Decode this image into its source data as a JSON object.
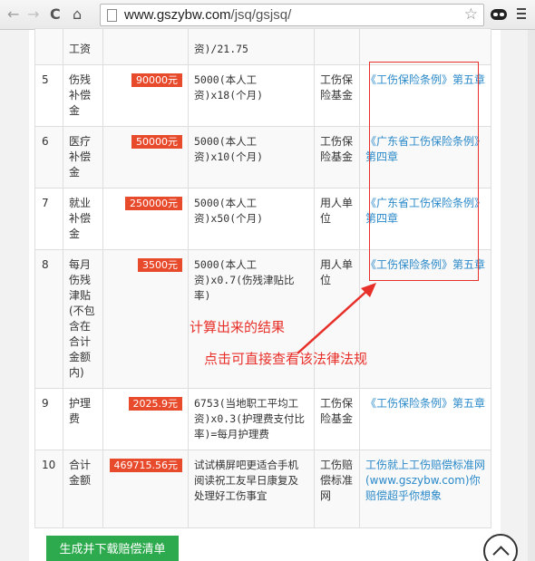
{
  "browser": {
    "url_host": "www.gszybw.com",
    "url_path": "/jsq/gsjsq/"
  },
  "table": {
    "rows": [
      {
        "no": "",
        "name": "工资",
        "amount": "",
        "formula": "资)/21.75",
        "payer": "",
        "law": ""
      },
      {
        "no": "5",
        "name": "伤残补偿金",
        "amount": "90000元",
        "formula": "5000(本人工资)x18(个月)",
        "payer": "工伤保险基金",
        "law": "《工伤保险条例》第五章"
      },
      {
        "no": "6",
        "name": "医疗补偿金",
        "amount": "50000元",
        "formula": "5000(本人工资)x10(个月)",
        "payer": "工伤保险基金",
        "law": "《广东省工伤保险条例》第四章"
      },
      {
        "no": "7",
        "name": "就业补偿金",
        "amount": "250000元",
        "formula": "5000(本人工资)x50(个月)",
        "payer": "用人单位",
        "law": "《广东省工伤保险条例》第四章"
      },
      {
        "no": "8",
        "name": "每月伤残津贴(不包含在合计金额内)",
        "amount": "3500元",
        "formula": "5000(本人工资)x0.7(伤残津贴比率)",
        "payer": "用人单位",
        "law": "《工伤保险条例》第五章"
      },
      {
        "no": "9",
        "name": "护理费",
        "amount": "2025.9元",
        "formula": "6753(当地职工平均工资)x0.3(护理费支付比率)=每月护理费",
        "payer": "工伤保险基金",
        "law": "《工伤保险条例》第五章"
      },
      {
        "no": "10",
        "name": "合计金额",
        "amount": "469715.56元",
        "formula": "试试横屏吧更适合手机阅读祝工友早日康复及处理好工伤事宜",
        "payer": "工伤赔偿标准网",
        "law": "工伤就上工伤赔偿标准网(www.gszybw.com)你赔偿超乎你想象"
      }
    ]
  },
  "annotations": {
    "result_note": "计算出来的结果",
    "law_note": "点击可直接查看该法律法规"
  },
  "buttons": {
    "generate_label": "生成并下载赔偿清单"
  },
  "colors": {
    "badge": "#e84a2c",
    "link": "#2a89c9",
    "annotation": "#e8302a",
    "button": "#2eaa4e"
  },
  "icons": [
    "back-icon",
    "forward-icon",
    "reload-icon",
    "home-icon",
    "page-icon",
    "star-icon",
    "extension-icon",
    "menu-icon",
    "back-to-top-icon"
  ]
}
